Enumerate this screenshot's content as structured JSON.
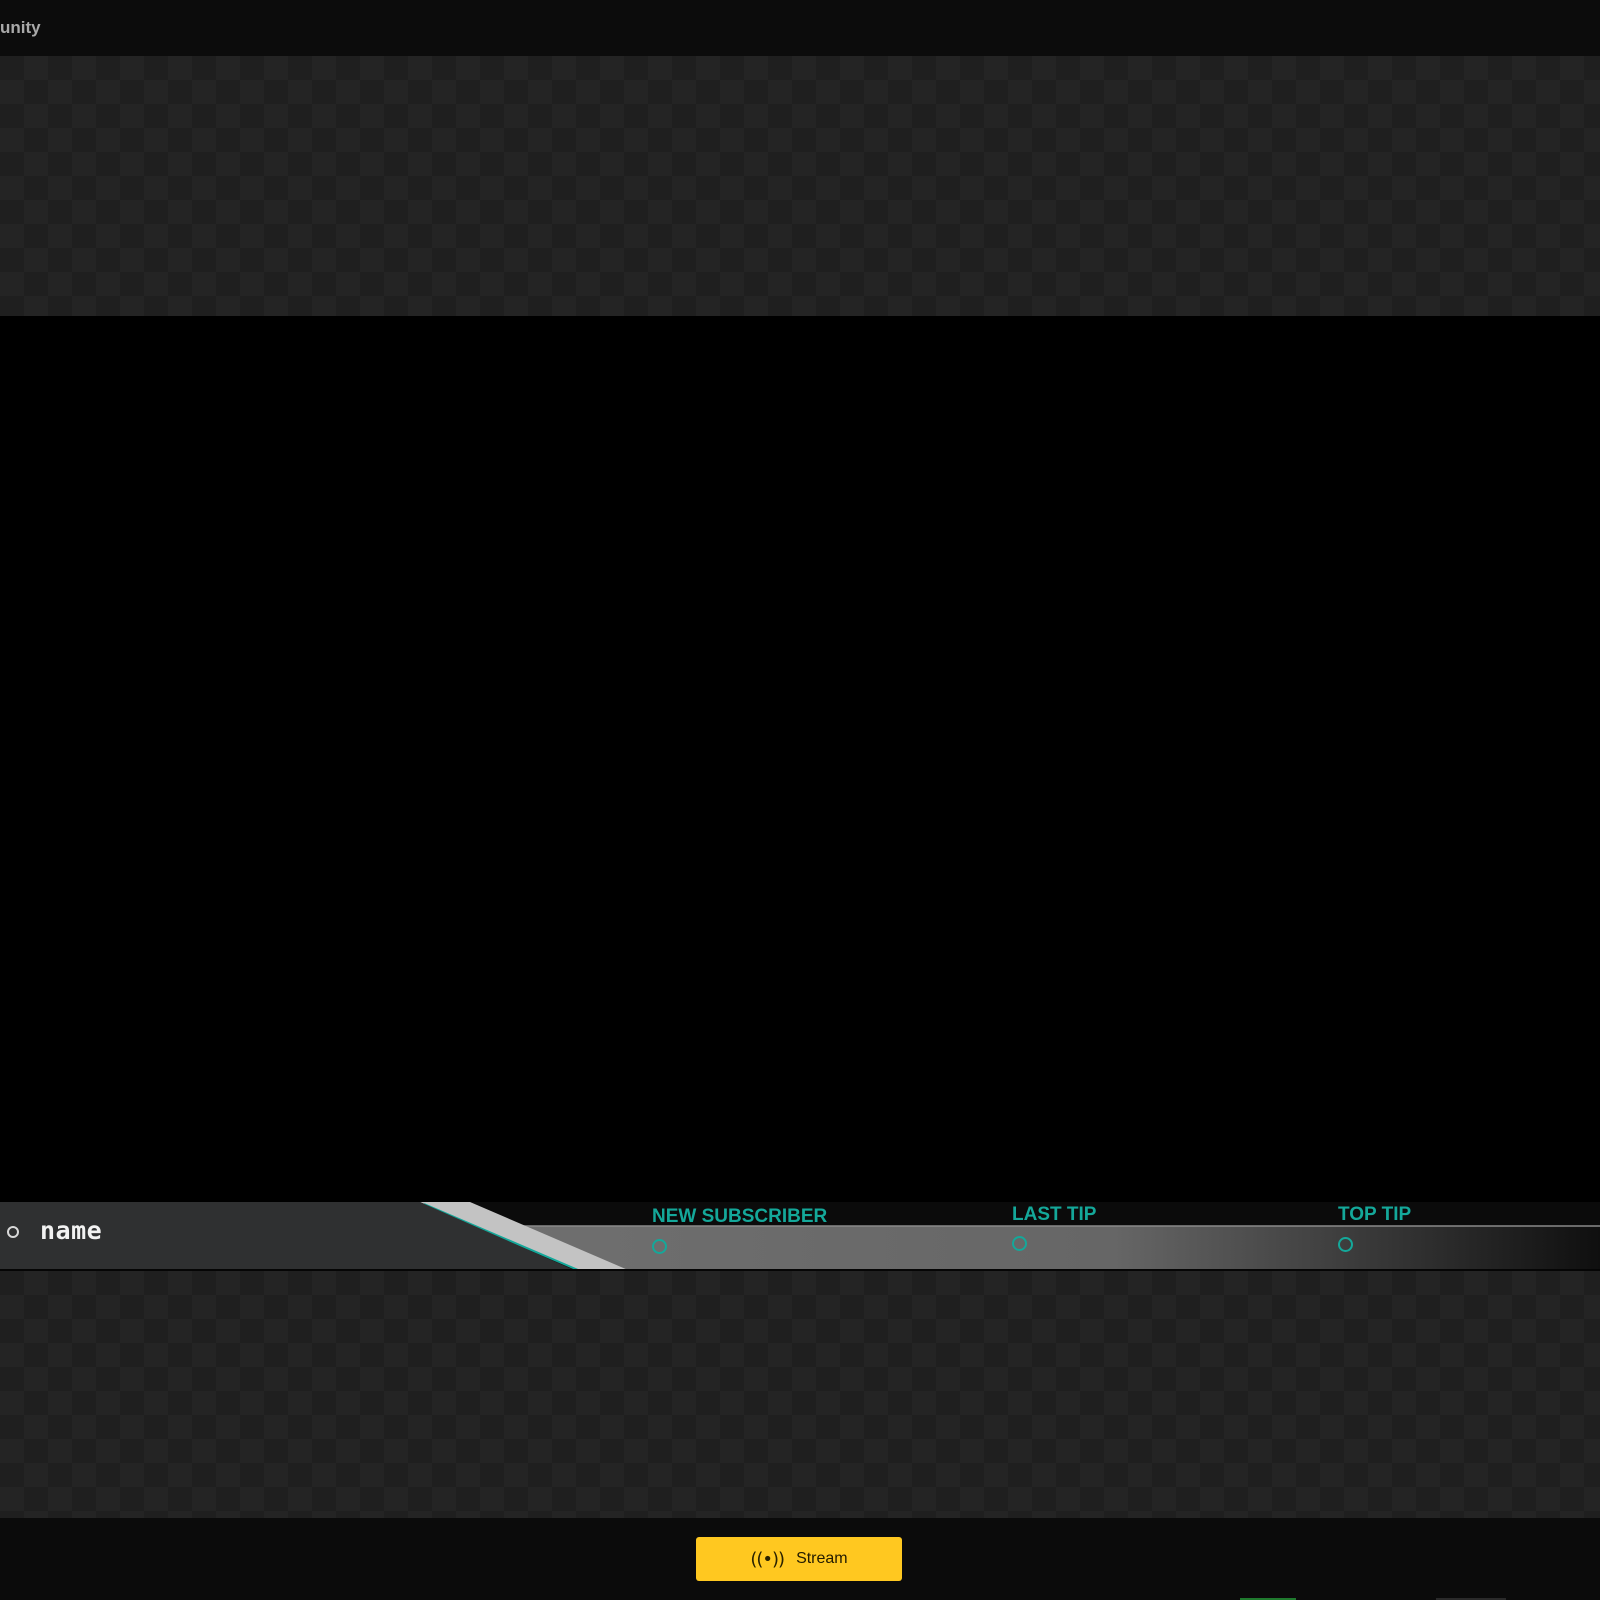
{
  "window": {
    "title_fragment": "unity"
  },
  "overlay": {
    "name_label": "name",
    "stats": [
      {
        "label": "NEW SUBSCRIBER"
      },
      {
        "label": "LAST TIP"
      },
      {
        "label": "TOP TIP"
      }
    ],
    "accent_color": "#14a89a"
  },
  "footer": {
    "stream_label": "Stream",
    "stream_icon": "broadcast-icon",
    "stream_icon_glyph": "((•))",
    "button_color": "#ffc820"
  }
}
